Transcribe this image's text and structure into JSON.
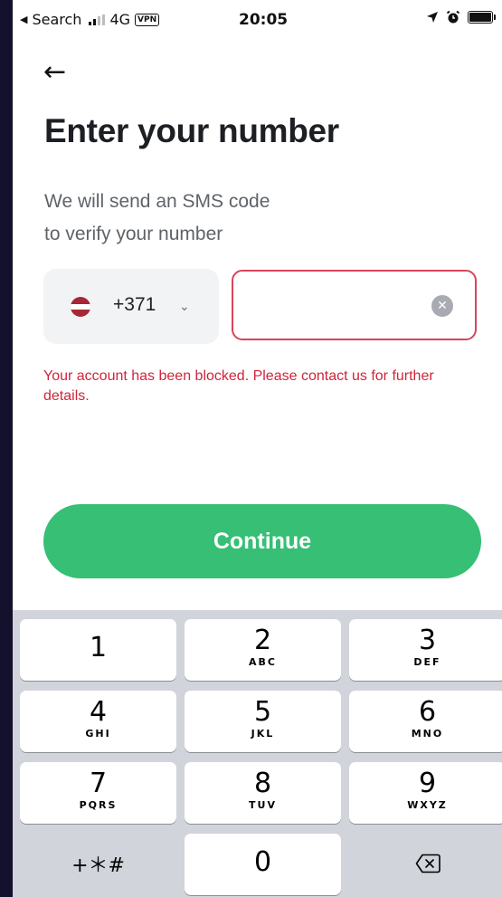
{
  "status_bar": {
    "back_label": "Search",
    "network": "4G",
    "vpn": "VPN",
    "time": "20:05",
    "icons": [
      "location-arrow-icon",
      "alarm-icon",
      "battery-icon"
    ]
  },
  "header": {
    "back_icon": "arrow-left-icon",
    "back_glyph": "←",
    "title": "Enter your number",
    "subtitle_line1": "We will send an SMS code",
    "subtitle_line2": "to verify your number"
  },
  "phone_form": {
    "country_code": "+371",
    "country_flag": "latvia-flag",
    "chevron_glyph": "⌄",
    "number_value": "",
    "clear_glyph": "✕",
    "error": "Your account has been blocked. Please contact us for further details."
  },
  "continue_label": "Continue",
  "colors": {
    "accent": "#36bf75",
    "error": "#d0243a",
    "input_border": "#d6455b"
  },
  "keypad": {
    "keys": [
      {
        "num": "1",
        "letters": ""
      },
      {
        "num": "2",
        "letters": "ABC"
      },
      {
        "num": "3",
        "letters": "DEF"
      },
      {
        "num": "4",
        "letters": "GHI"
      },
      {
        "num": "5",
        "letters": "JKL"
      },
      {
        "num": "6",
        "letters": "MNO"
      },
      {
        "num": "7",
        "letters": "PQRS"
      },
      {
        "num": "8",
        "letters": "TUV"
      },
      {
        "num": "9",
        "letters": "WXYZ"
      },
      {
        "num": "0",
        "letters": ""
      }
    ],
    "symbols_label": "+＊#",
    "delete_icon": "backspace-icon"
  }
}
